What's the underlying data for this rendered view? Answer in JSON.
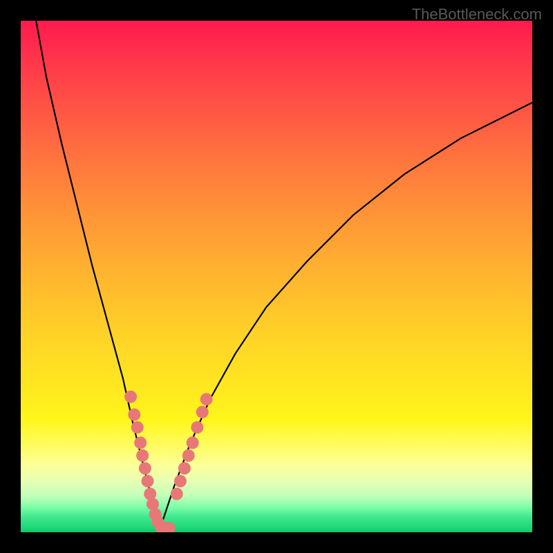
{
  "watermark": "TheBottleneck.com",
  "chart_data": {
    "type": "line",
    "title": "",
    "xlabel": "",
    "ylabel": "",
    "xlim": [
      0,
      100
    ],
    "ylim": [
      0,
      100
    ],
    "curves": {
      "left": {
        "x": [
          3,
          5,
          8,
          11,
          14,
          17,
          20,
          22,
          24,
          25.5,
          26.5,
          27
        ],
        "y": [
          100,
          89,
          76,
          64,
          52,
          41,
          30,
          21,
          13,
          7,
          3,
          0
        ]
      },
      "right": {
        "x": [
          27,
          28,
          30,
          33,
          37,
          42,
          48,
          56,
          65,
          75,
          86,
          100
        ],
        "y": [
          0,
          3,
          9,
          17,
          26,
          35,
          44,
          53,
          62,
          70,
          77,
          84
        ]
      }
    },
    "data_points_left": [
      {
        "x": 21.5,
        "y": 26.5
      },
      {
        "x": 22.2,
        "y": 23.0
      },
      {
        "x": 22.8,
        "y": 20.5
      },
      {
        "x": 23.4,
        "y": 17.5
      },
      {
        "x": 23.8,
        "y": 15.0
      },
      {
        "x": 24.3,
        "y": 12.5
      },
      {
        "x": 24.8,
        "y": 10.0
      },
      {
        "x": 25.3,
        "y": 7.5
      },
      {
        "x": 25.8,
        "y": 5.5
      },
      {
        "x": 26.3,
        "y": 3.5
      },
      {
        "x": 26.8,
        "y": 2.0
      },
      {
        "x": 27.5,
        "y": 0.8
      },
      {
        "x": 28.3,
        "y": 0.8
      },
      {
        "x": 29.0,
        "y": 0.8
      }
    ],
    "data_points_right": [
      {
        "x": 30.5,
        "y": 7.5
      },
      {
        "x": 31.2,
        "y": 10.0
      },
      {
        "x": 32.0,
        "y": 12.5
      },
      {
        "x": 32.8,
        "y": 15.0
      },
      {
        "x": 33.6,
        "y": 17.5
      },
      {
        "x": 34.5,
        "y": 20.5
      },
      {
        "x": 35.5,
        "y": 23.5
      },
      {
        "x": 36.3,
        "y": 26.0
      }
    ],
    "gradient": {
      "top_color": "#ff1a4e",
      "bottom_color": "#10c868",
      "description": "Red-orange-yellow-green vertical gradient"
    },
    "point_color": "#e87878",
    "curve_color": "#000000"
  }
}
